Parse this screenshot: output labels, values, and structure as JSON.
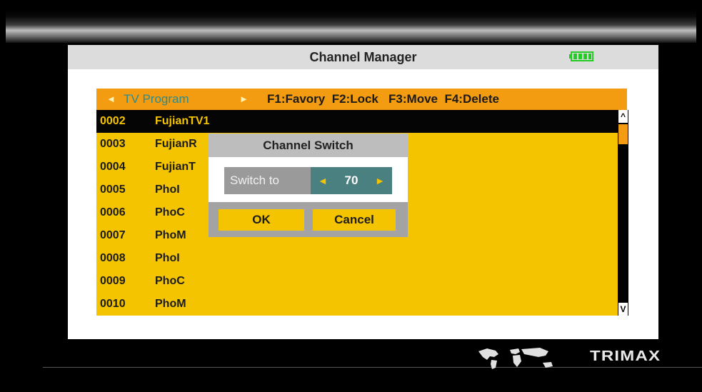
{
  "header": {
    "title": "Channel Manager",
    "battery_icon": "battery-icon",
    "battery_color": "#22cc22"
  },
  "tabbar": {
    "left_arrow": "◄",
    "program_label": "TV Program",
    "right_arrow": "►",
    "function_keys": "F1:Favory  F2:Lock   F3:Move  F4:Delete"
  },
  "channels": [
    {
      "num": "0002",
      "name": "FujianTV1",
      "selected": true
    },
    {
      "num": "0003",
      "name": "FujianR"
    },
    {
      "num": "0004",
      "name": "FujianT"
    },
    {
      "num": "0005",
      "name": "PhoI"
    },
    {
      "num": "0006",
      "name": "PhoC"
    },
    {
      "num": "0007",
      "name": "PhoM"
    },
    {
      "num": "0008",
      "name": "PhoI"
    },
    {
      "num": "0009",
      "name": "PhoC"
    },
    {
      "num": "0010",
      "name": "PhoM"
    }
  ],
  "scrollbar": {
    "up": "^",
    "down": "V"
  },
  "dialog": {
    "title": "Channel Switch",
    "label": "Switch to",
    "left_arrow": "◄",
    "value": "70",
    "right_arrow": "►",
    "ok": "OK",
    "cancel": "Cancel"
  },
  "footer": {
    "brand": "TRIMAX",
    "map_icon": "world-map-icon"
  },
  "colors": {
    "accent": "#f39c12",
    "list": "#f5c400",
    "teal": "#4a8080"
  }
}
